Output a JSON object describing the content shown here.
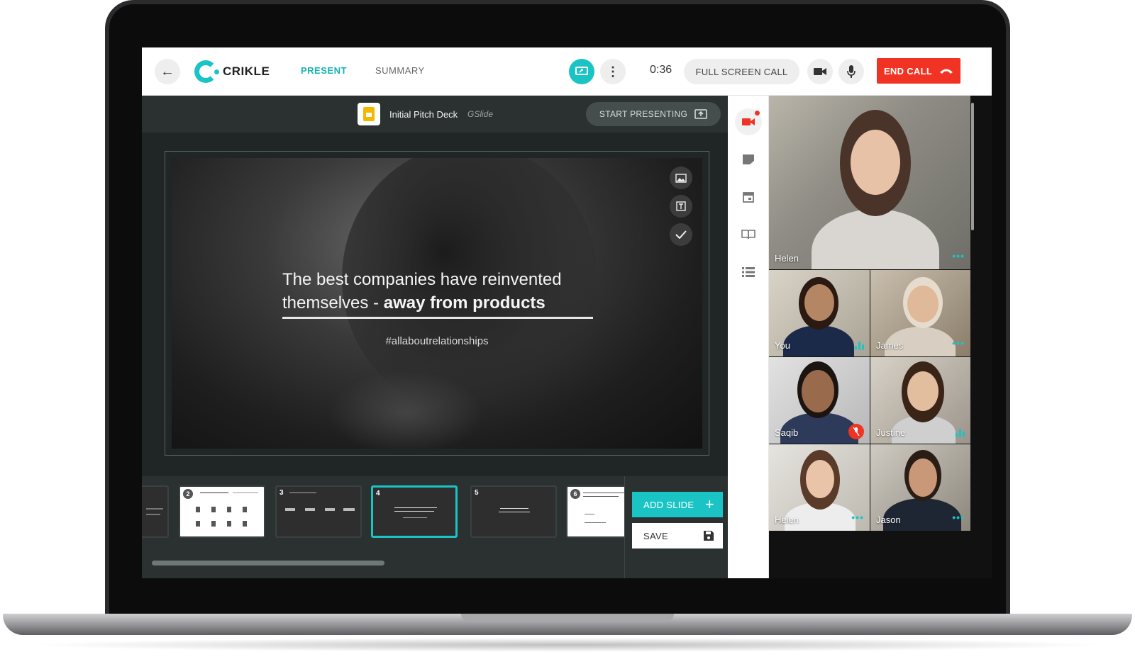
{
  "app": {
    "brand": "CRIKLE"
  },
  "header": {
    "tabs": [
      {
        "label": "PRESENT",
        "active": true
      },
      {
        "label": "SUMMARY",
        "active": false
      }
    ],
    "timer": "0:36",
    "fullscreen_label": "FULL SCREEN CALL",
    "end_call_label": "END CALL"
  },
  "presentation": {
    "doc_title": "Initial Pitch Deck",
    "doc_type": "GSlide",
    "start_label": "START PRESENTING",
    "slide": {
      "line1": "The best companies have reinvented",
      "line2_plain": "themselves - ",
      "line2_bold": "away from products",
      "hashtag": "#allaboutrelationships"
    },
    "thumbnails": [
      {
        "num": "",
        "style": "dark"
      },
      {
        "num": "2",
        "style": "light"
      },
      {
        "num": "3",
        "style": "dark"
      },
      {
        "num": "4",
        "style": "dark",
        "active": true
      },
      {
        "num": "5",
        "style": "dark"
      },
      {
        "num": "6",
        "style": "light"
      }
    ],
    "add_slide_label": "ADD SLIDE",
    "save_label": "SAVE"
  },
  "colors": {
    "accent": "#1bc4c4",
    "danger": "#f03322"
  },
  "participants": [
    {
      "name": "Helen",
      "indicator": "dots"
    },
    {
      "name": "You",
      "indicator": "wave"
    },
    {
      "name": "James",
      "indicator": "dots"
    },
    {
      "name": "Saqib",
      "indicator": "muted"
    },
    {
      "name": "Justine",
      "indicator": "wave"
    },
    {
      "name": "Helen",
      "indicator": "dots"
    },
    {
      "name": "Jason",
      "indicator": "dots"
    }
  ]
}
